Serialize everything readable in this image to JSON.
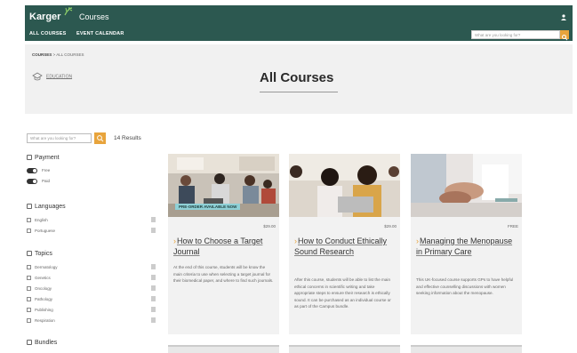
{
  "header": {
    "logo": "Karger",
    "app": "Courses",
    "nav": [
      "ALL COURSES",
      "EVENT CALENDAR"
    ],
    "search_placeholder": "What are you looking for?"
  },
  "hero": {
    "breadcrumb_root": "COURSES",
    "breadcrumb_sep": ">",
    "breadcrumb_current": "ALL COURSES",
    "category": "EDUCATION",
    "title": "All Courses"
  },
  "sidebar": {
    "search_placeholder": "What are you looking for?",
    "results": "14 Results",
    "payment": {
      "heading": "Payment",
      "options": [
        "Free",
        "Paid"
      ]
    },
    "languages": {
      "heading": "Languages",
      "options": [
        "English",
        "Portuguese"
      ]
    },
    "topics": {
      "heading": "Topics",
      "options": [
        "Dermatology",
        "Genetics",
        "Oncology",
        "Pathology",
        "Publishing",
        "Respiration"
      ]
    },
    "bundles": {
      "heading": "Bundles"
    }
  },
  "cards": [
    {
      "badge": "PRE-ORDER AVAILABLE NOW",
      "price": "$29.00",
      "title": "How to Choose a Target Journal",
      "desc": "At the end of this course, students will be know the main criteria to use when selecting a target journal for their biomedical paper, and where to find such journals."
    },
    {
      "badge": "",
      "price": "$29.00",
      "title": "How to Conduct Ethically Sound Research",
      "desc": "After this course, students will be able to list the main ethical concerns in scientific writing and take appropriate steps to ensure their research is ethically sound. It can be purchased as an individual course or as part of the Campus bundle."
    },
    {
      "badge": "",
      "price": "FREE",
      "title": "Managing the Menopause in Primary Care",
      "desc": "This UK-focused course supports GPs to have helpful and effective counselling discussions with women seeking information about the menopause."
    }
  ],
  "colors": {
    "header": "#2c5850",
    "accent": "#e8a43c",
    "badge": "#8fd0d6"
  }
}
